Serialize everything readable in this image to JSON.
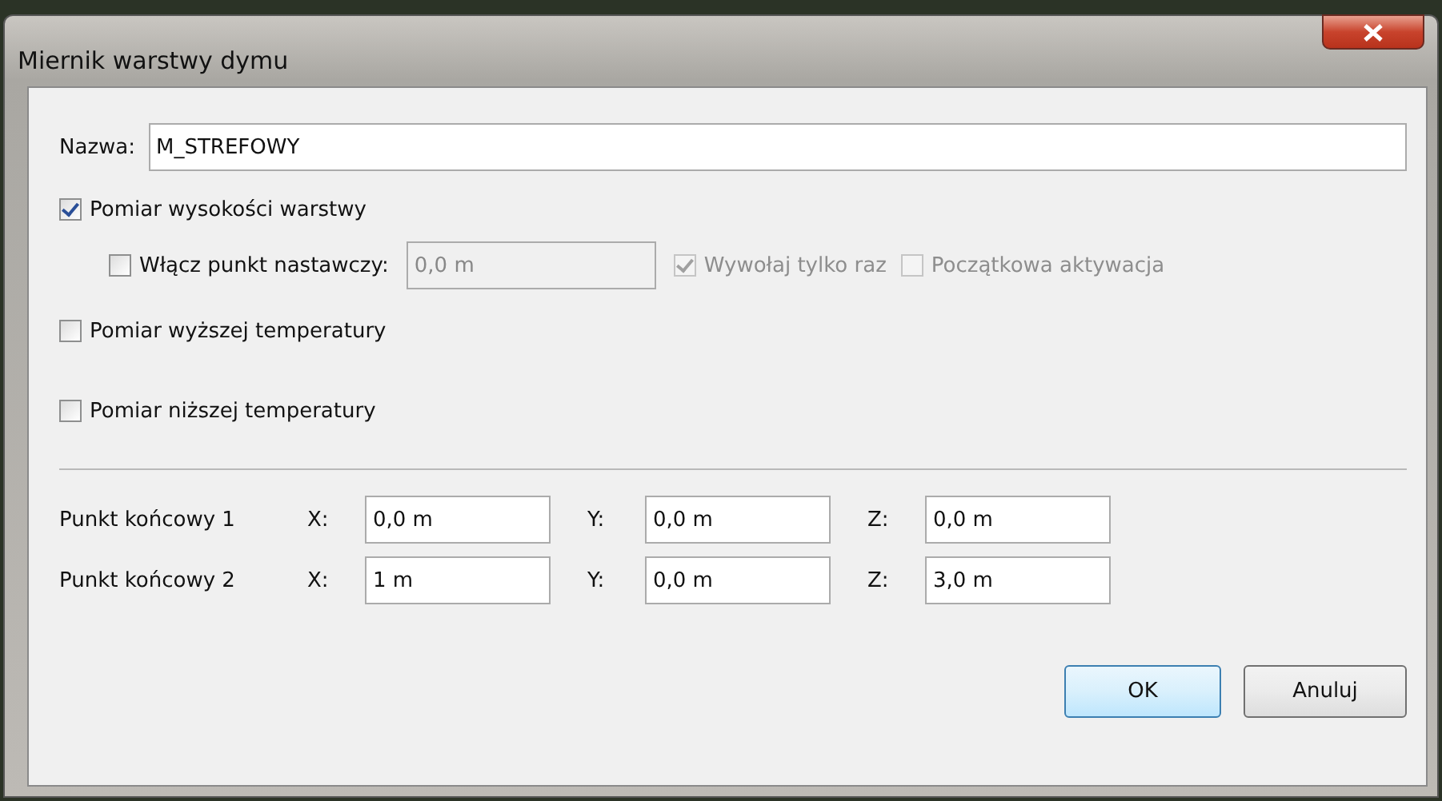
{
  "window": {
    "title": "Miernik warstwy dymu"
  },
  "name_field": {
    "label": "Nazwa:",
    "value": "M_STREFOWY"
  },
  "layer_height": {
    "label": "Pomiar wysokości warstwy",
    "checked": true
  },
  "setpoint": {
    "label": "Włącz punkt nastawczy:",
    "checked": false,
    "value": "0,0 m",
    "disabled": true,
    "options": [
      {
        "label": "Wywołaj tylko raz",
        "checked": true,
        "disabled": true
      },
      {
        "label": "Początkowa aktywacja",
        "checked": false,
        "disabled": true
      }
    ]
  },
  "measurements": [
    {
      "label": "Pomiar wyższej temperatury",
      "checked": false
    },
    {
      "label": "Pomiar niższej temperatury",
      "checked": false
    }
  ],
  "endpoints": [
    {
      "label": "Punkt końcowy 1",
      "coords": [
        {
          "axis": "X:",
          "value": "0,0 m"
        },
        {
          "axis": "Y:",
          "value": "0,0 m"
        },
        {
          "axis": "Z:",
          "value": "0,0 m"
        }
      ]
    },
    {
      "label": "Punkt końcowy 2",
      "coords": [
        {
          "axis": "X:",
          "value": "1 m"
        },
        {
          "axis": "Y:",
          "value": "0,0 m"
        },
        {
          "axis": "Z:",
          "value": "3,0 m"
        }
      ]
    }
  ],
  "buttons": [
    {
      "label": "OK",
      "default": true
    },
    {
      "label": "Anuluj",
      "default": false
    }
  ]
}
